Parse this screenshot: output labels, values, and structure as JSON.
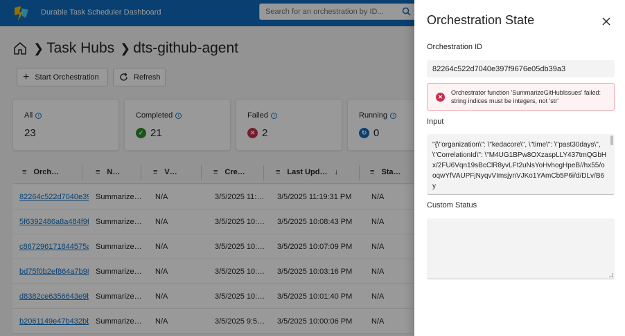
{
  "app": {
    "title": "Durable Task Scheduler Dashboard"
  },
  "search": {
    "placeholder": "Search for an orchestration by ID..."
  },
  "breadcrumb": {
    "level1": "Task Hubs",
    "level2": "dts-github-agent"
  },
  "toolbar": {
    "start_label": "Start Orchestration",
    "refresh_label": "Refresh"
  },
  "cards": [
    {
      "label": "All",
      "value": "23",
      "status": "none",
      "color": ""
    },
    {
      "label": "Completed",
      "value": "21",
      "status": "check",
      "color": "#2e8b2e"
    },
    {
      "label": "Failed",
      "value": "2",
      "status": "x",
      "color": "#c4314b"
    },
    {
      "label": "Running",
      "value": "0",
      "status": "sync",
      "color": "#0f6cbd"
    }
  ],
  "table": {
    "headers": [
      "Orch…",
      "N…",
      "V…",
      "Cre…",
      "Last Upd…",
      "Sta…"
    ],
    "rows": [
      [
        "82264c522d7040e39",
        "Summarize…",
        "N/A",
        "3/5/2025 11:…",
        "3/5/2025 11:19:31 PM",
        "N/A"
      ],
      [
        "5f6392486a8a484f9f",
        "Summarize…",
        "N/A",
        "3/5/2025 10:…",
        "3/5/2025 10:08:43 PM",
        "N/A"
      ],
      [
        "c867296171844575a",
        "Summarize…",
        "N/A",
        "3/5/2025 10:…",
        "3/5/2025 10:07:09 PM",
        "N/A"
      ],
      [
        "bd75f0b2ef864a7b98",
        "Summarize…",
        "N/A",
        "3/5/2025 10:…",
        "3/5/2025 10:03:16 PM",
        "N/A"
      ],
      [
        "d8382ce6356643e9b",
        "Summarize…",
        "N/A",
        "3/5/2025 10:…",
        "3/5/2025 10:01:40 PM",
        "N/A"
      ],
      [
        "b2061149e47b432bb",
        "Summarize…",
        "N/A",
        "3/5/2025 9:5…",
        "3/5/2025 10:00:06 PM",
        "N/A"
      ]
    ]
  },
  "panel": {
    "title": "Orchestration State",
    "id_label": "Orchestration ID",
    "id_value": "82264c522d7040e397f9676e05db39a3",
    "error_text": "Orchestrator function 'SummarizeGitHubIssues' failed: string indices must be integers, not 'str'",
    "input_label": "Input",
    "input_value": "\"{\\\"organization\\\": \\\"kedacore\\\", \\\"time\\\": \\\"past30days\\\", \\\"CorrelationId\\\": \\\"M4UG1BPw8OXzaspLLY437tmQGbHx/2FU6Vqn19sBcClR8yvLFt2uNsYoHvhogHpeB//hx55/ooqwYfVAUPFjNyqvVImsjynVJKo1YAmCb5P6i/d/DLv/B6y",
    "custom_status_label": "Custom Status"
  }
}
